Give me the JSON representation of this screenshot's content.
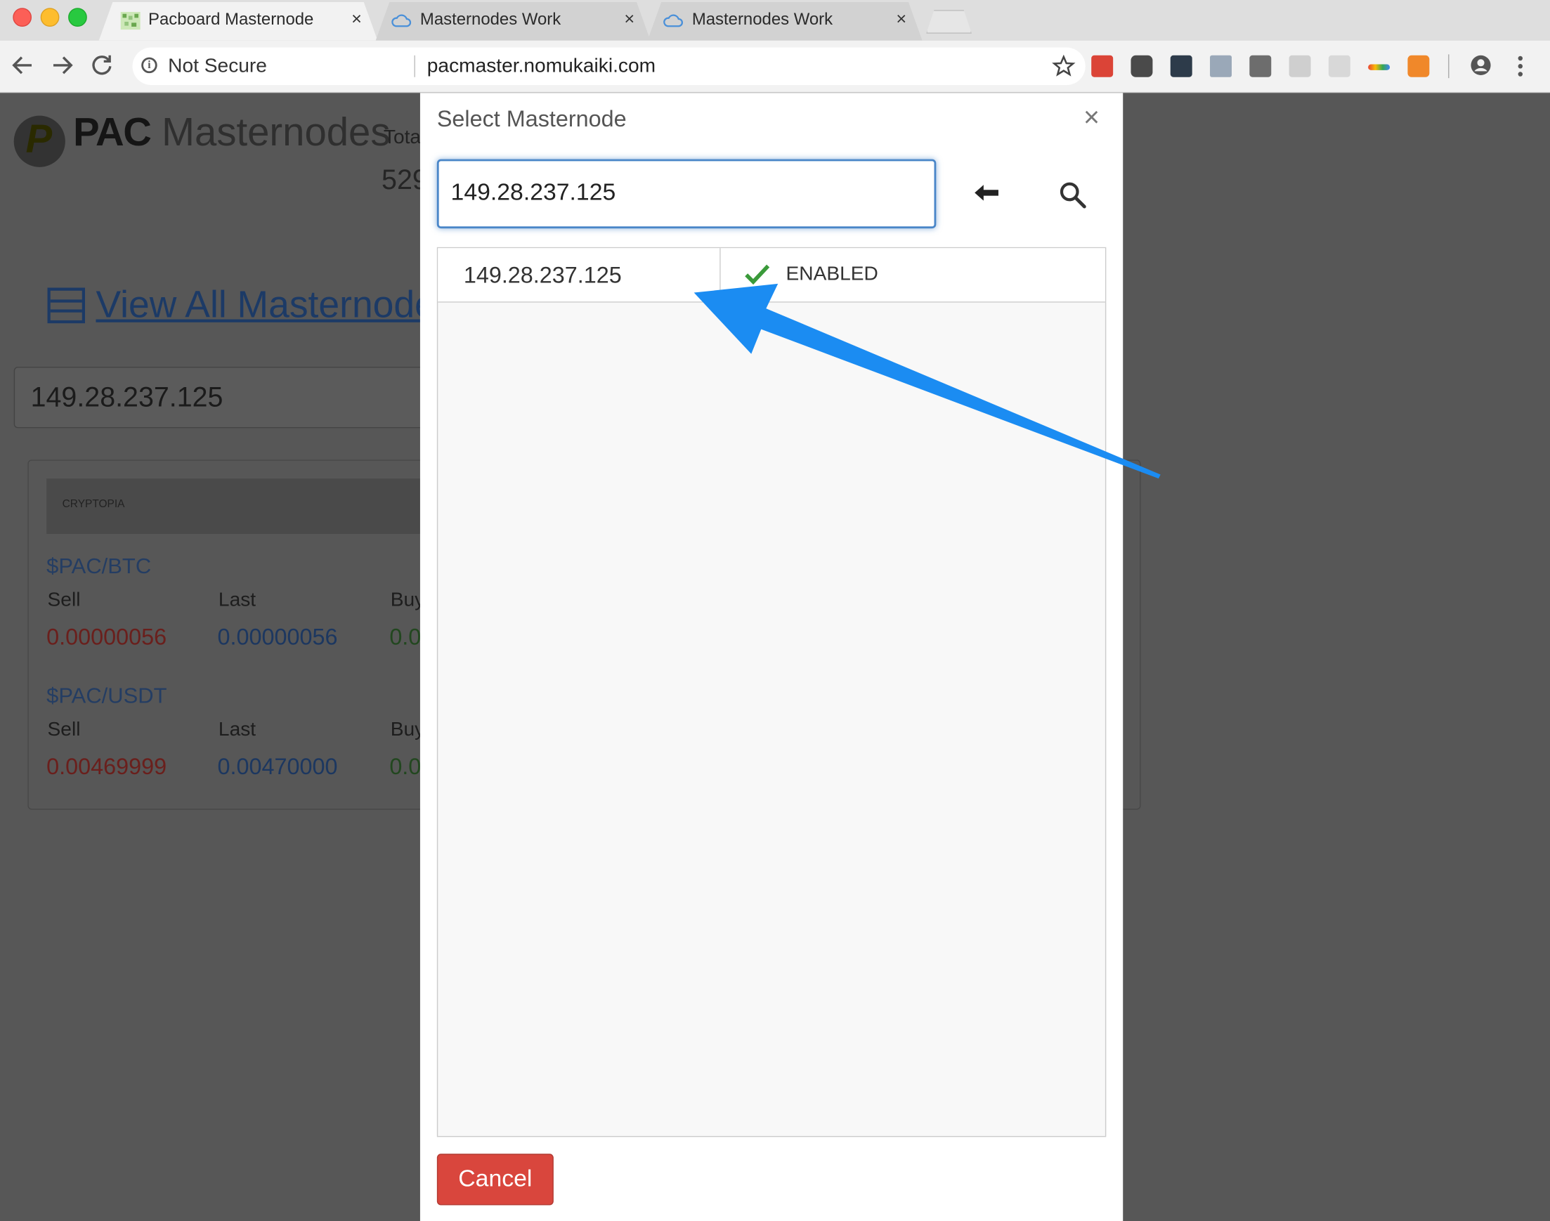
{
  "browser": {
    "tabs": [
      {
        "title": "Pacboard Masternode",
        "active": true
      },
      {
        "title": "Masternodes Work",
        "active": false
      },
      {
        "title": "Masternodes Work",
        "active": false
      }
    ],
    "close_glyph": "×",
    "security_label": "Not Secure",
    "url": "pacmaster.nomukaiki.com"
  },
  "page": {
    "brand_bold": "PAC",
    "brand_light": "Masternodes",
    "total_label": "Tota",
    "total_value": "529",
    "view_all": "View All Masternode",
    "ip_value": "149.28.237.125",
    "exchange": "CRYPTOPIA",
    "markets": [
      {
        "pair": "$PAC/BTC",
        "sell_label": "Sell",
        "last_label": "Last",
        "buy_label": "Buy",
        "sell": "0.00000056",
        "last": "0.00000056",
        "buy": "0.0"
      },
      {
        "pair": "$PAC/USDT",
        "sell_label": "Sell",
        "last_label": "Last",
        "buy_label": "Buy",
        "sell": "0.00469999",
        "last": "0.00470000",
        "buy": "0.0"
      }
    ]
  },
  "modal": {
    "title": "Select Masternode",
    "close": "×",
    "search_value": "149.28.237.125",
    "results": [
      {
        "ip": "149.28.237.125",
        "status": "ENABLED"
      }
    ],
    "cancel_label": "Cancel"
  },
  "colors": {
    "annotation_arrow": "#1b8cf2",
    "cancel_button": "#d9463d",
    "focus_border": "#4a86c8",
    "check": "#3a9a3a"
  }
}
